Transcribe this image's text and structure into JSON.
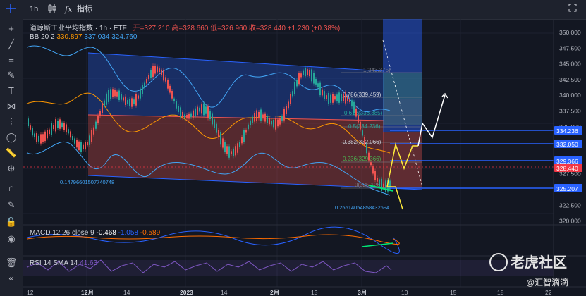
{
  "header": {
    "timeframe": "1h",
    "candle_icon": "candlestick-icon",
    "indicators_label": "指标",
    "indicators_icon": "fx-icon"
  },
  "legend": {
    "symbol": "道琼斯工业平均指数 · 1h · ETF",
    "open_label": "开=",
    "open": "327.210",
    "high_label": "高=",
    "high": "328.660",
    "low_label": "低=",
    "low": "326.960",
    "close_label": "收=",
    "close": "328.440",
    "change": "+1.230 (+0.38%)",
    "bb_name": "BB 20 2",
    "bb_basis": "330.897",
    "bb_upper": "337.034",
    "bb_lower": "324.760"
  },
  "fib": {
    "l1": "1(343.375)",
    "l0786": "0.786(339.459)",
    "l0618": "0.618(336.385)",
    "l05": "0.5(334.236)",
    "l0382": "0.382(332.066)",
    "l0236": "0.236(329.366)",
    "l0": "0(325.126)"
  },
  "channel_labels": {
    "upper_note": "0.14796601507740748",
    "lower_note": "0.25514054858432694"
  },
  "price_axis": {
    "ticks": [
      "350.000",
      "347.500",
      "345.000",
      "342.500",
      "340.000",
      "337.500",
      "335.000",
      "332.500",
      "330.000",
      "327.500",
      "325.000",
      "322.500",
      "320.000"
    ],
    "badges": [
      {
        "value": "334.236",
        "color": "#2962ff"
      },
      {
        "value": "332.050",
        "color": "#2962ff"
      },
      {
        "value": "329.366",
        "color": "#2962ff"
      },
      {
        "value": "328.440",
        "color": "#f23645"
      },
      {
        "value": "325.207",
        "color": "#2962ff"
      }
    ]
  },
  "time_axis": [
    "12",
    "12月",
    "14",
    "2023",
    "14",
    "2月",
    "13",
    "3月",
    "10",
    "15",
    "18",
    "22"
  ],
  "macd": {
    "label": "MACD 12 26 close 9",
    "v1": "-0.468",
    "v2": "-1.058",
    "v3": "-0.589"
  },
  "rsi": {
    "label": "RSI 14 SMA 14",
    "v1": "41.63"
  },
  "watermark": {
    "text": "老虎社区",
    "sub": "@汇智滴滴"
  },
  "colors": {
    "bg": "#131722",
    "up": "#26a69a",
    "down": "#ef5350",
    "blue": "#2962ff"
  }
}
